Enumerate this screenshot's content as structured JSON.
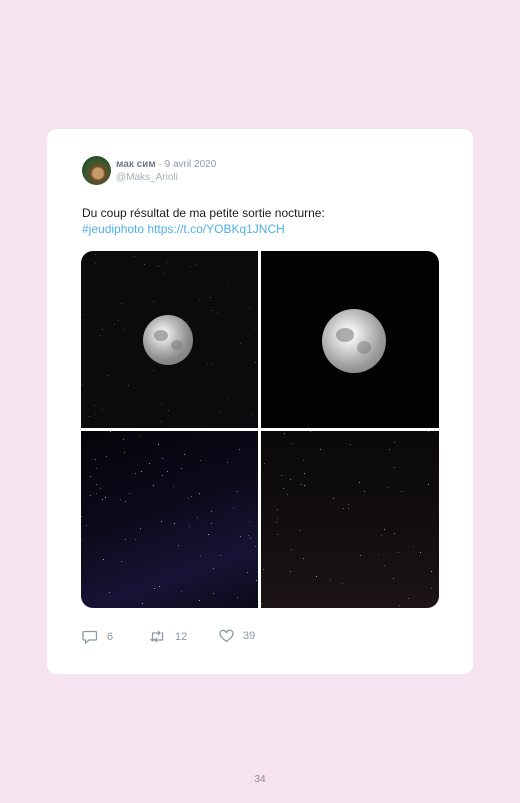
{
  "tweet": {
    "author_name": "мак сим",
    "date": "· 9 avril 2020",
    "handle": "@Maks_Arioli",
    "text": "Du coup résultat de ma petite sortie nocturne:",
    "hashtag": "#jeudiphoto",
    "link": "https://t.co/YOBKq1JNCH",
    "photos": [
      {
        "label": "moon-small"
      },
      {
        "label": "moon-large"
      },
      {
        "label": "stars-blue"
      },
      {
        "label": "stars-red"
      }
    ],
    "stats": {
      "replies": "6",
      "retweets": "12",
      "likes": "39"
    }
  },
  "colors": {
    "page_bg": "#f5e4ef",
    "link": "#4fb0e6"
  },
  "page": {
    "number": "34"
  }
}
